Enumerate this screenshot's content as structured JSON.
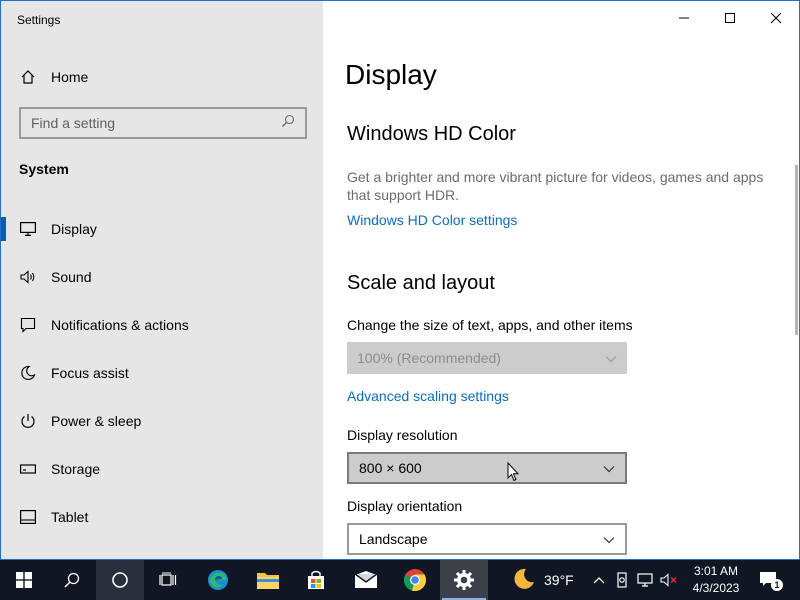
{
  "window": {
    "title": "Settings",
    "controls": [
      "minimize",
      "maximize",
      "close"
    ]
  },
  "sidebar": {
    "home_label": "Home",
    "search": {
      "placeholder": "Find a setting",
      "value": ""
    },
    "section_label": "System",
    "items": [
      {
        "label": "Display",
        "icon": "monitor-icon",
        "active": true
      },
      {
        "label": "Sound",
        "icon": "speaker-icon"
      },
      {
        "label": "Notifications & actions",
        "icon": "notification-icon"
      },
      {
        "label": "Focus assist",
        "icon": "moon-icon"
      },
      {
        "label": "Power & sleep",
        "icon": "power-icon"
      },
      {
        "label": "Storage",
        "icon": "storage-icon"
      },
      {
        "label": "Tablet",
        "icon": "tablet-icon"
      }
    ]
  },
  "main": {
    "title": "Display",
    "hdr": {
      "heading": "Windows HD Color",
      "description": "Get a brighter and more vibrant picture for videos, games and apps that support HDR.",
      "link": "Windows HD Color settings"
    },
    "scale": {
      "heading": "Scale and layout",
      "change_size_label": "Change the size of text, apps, and other items",
      "scale_value": "100% (Recommended)",
      "advanced_link": "Advanced scaling settings",
      "resolution_label": "Display resolution",
      "resolution_value": "800 × 600",
      "orientation_label": "Display orientation",
      "orientation_value": "Landscape"
    }
  },
  "taskbar": {
    "weather_temp": "39°F",
    "time": "3:01 AM",
    "date": "4/3/2023",
    "notification_count": "1"
  },
  "colors": {
    "accent": "#0063b1",
    "link": "#0a6dc2",
    "sidebar_bg": "#e6e6e6",
    "taskbar_bg": "#101623"
  }
}
